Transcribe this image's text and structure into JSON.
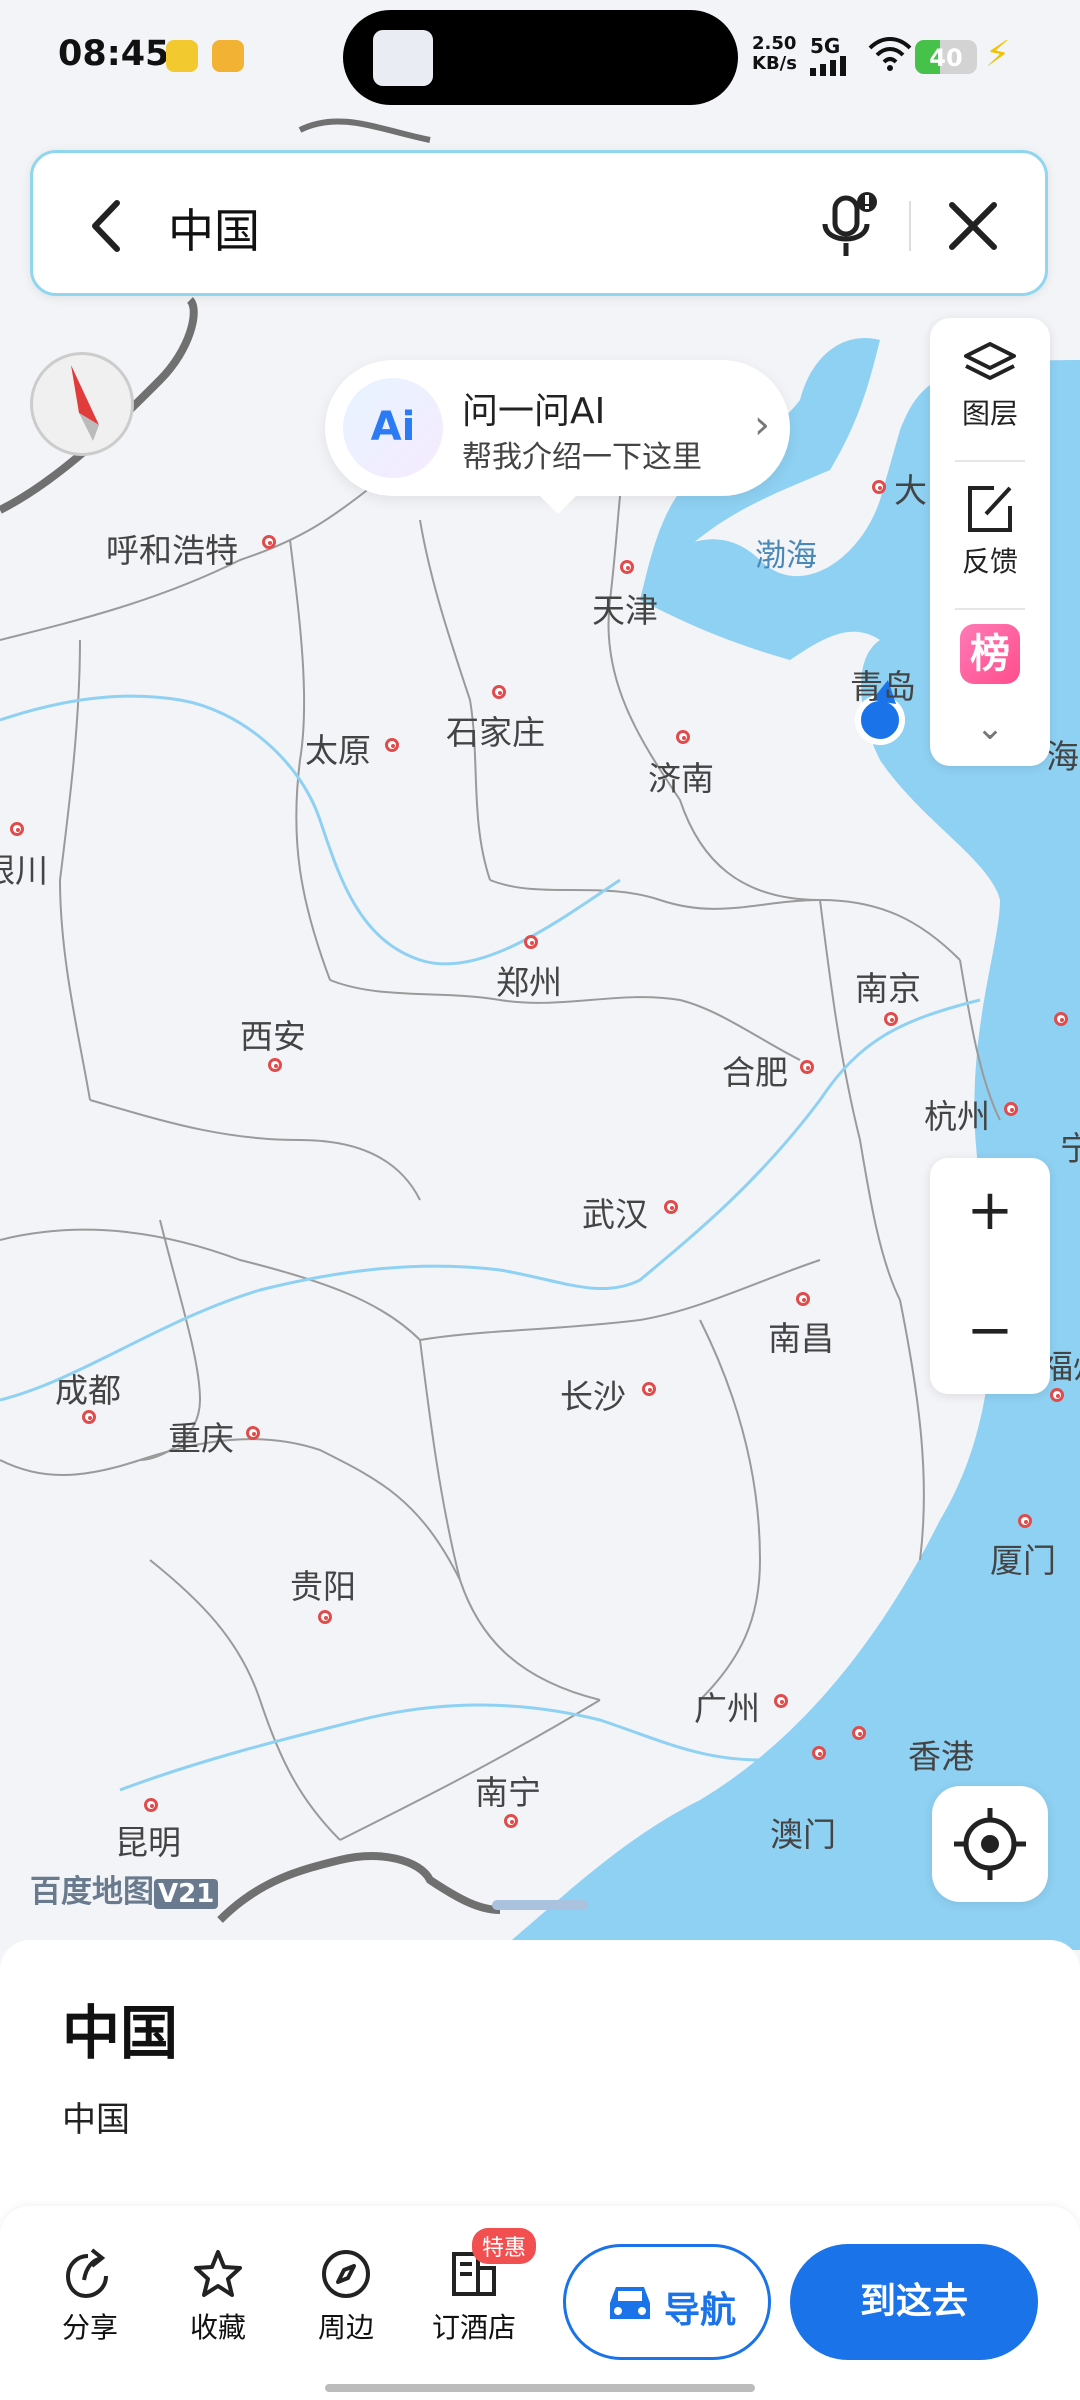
{
  "status_bar": {
    "time": "08:45",
    "net_speed": "2.50",
    "net_unit": "KB/s",
    "network": "5G",
    "battery": "40",
    "battery_level": 0.4
  },
  "search": {
    "query": "中国"
  },
  "ai_bubble": {
    "logo": "Ai",
    "title": "问一问AI",
    "subtitle": "帮我介绍一下这里"
  },
  "layer_panel": {
    "layers_label": "图层",
    "feedback_label": "反馈",
    "ranking_badge": "榜"
  },
  "map": {
    "sea_labels": [
      "渤海"
    ],
    "cities": [
      {
        "name": "呼和浩特"
      },
      {
        "name": "天津"
      },
      {
        "name": "石家庄"
      },
      {
        "name": "太原"
      },
      {
        "name": "济南"
      },
      {
        "name": "青岛"
      },
      {
        "name": "郑州"
      },
      {
        "name": "西安"
      },
      {
        "name": "南京"
      },
      {
        "name": "合肥"
      },
      {
        "name": "杭州"
      },
      {
        "name": "武汉"
      },
      {
        "name": "南昌"
      },
      {
        "name": "长沙"
      },
      {
        "name": "成都"
      },
      {
        "name": "重庆"
      },
      {
        "name": "贵阳"
      },
      {
        "name": "厦门"
      },
      {
        "name": "广州"
      },
      {
        "name": "香港"
      },
      {
        "name": "澳门"
      },
      {
        "name": "南宁"
      },
      {
        "name": "昆明"
      },
      {
        "name": "银川"
      },
      {
        "name": "大"
      },
      {
        "name": "海"
      },
      {
        "name": "宁"
      },
      {
        "name": "福州"
      }
    ]
  },
  "brand": {
    "name": "百度地图",
    "version": "V21"
  },
  "place": {
    "title": "中国",
    "subtitle": "中国"
  },
  "actions": {
    "share": "分享",
    "favorite": "收藏",
    "nearby": "周边",
    "hotel": "订酒店",
    "hotel_badge": "特惠",
    "navigate": "导航",
    "go_here": "到这去"
  },
  "colors": {
    "accent": "#1a73e8",
    "sea": "#8fd1f3",
    "city_dot": "#e14b4b"
  }
}
